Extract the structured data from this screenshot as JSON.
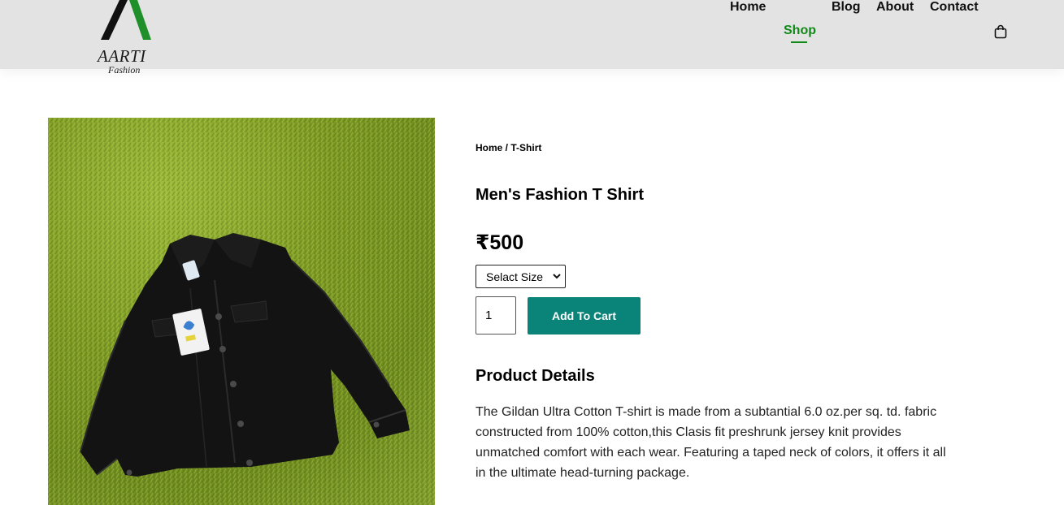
{
  "brand": {
    "name": "AARTI",
    "tagline": "Fashion"
  },
  "nav": {
    "items": [
      {
        "label": "Home"
      },
      {
        "label": "Shop"
      },
      {
        "label": "Blog"
      },
      {
        "label": "About"
      },
      {
        "label": "Contact"
      }
    ],
    "active": "Shop",
    "cart_icon": "shopping-bag-icon"
  },
  "breadcrumb": {
    "home": "Home",
    "separator": " / ",
    "current": "T-Shirt"
  },
  "product": {
    "title": "Men's Fashion T Shirt",
    "price": "₹500",
    "size_select": {
      "selected": "Selact Size"
    },
    "quantity": "1",
    "add_to_cart_label": "Add To Cart",
    "details_heading": "Product Details",
    "details_text": "The Gildan Ultra Cotton T-shirt is made from a subtantial 6.0 oz.per sq. td. fabric constructed from 100% cotton,this Clasis fit preshrunk jersey knit provides unmatched comfort with each wear. Featuring a taped neck of colors, it offers it all in the ultimate head-turning package."
  },
  "colors": {
    "accent_green": "#0f8a17",
    "button_teal": "#0a8378",
    "header_bg": "#e3e3e3"
  }
}
